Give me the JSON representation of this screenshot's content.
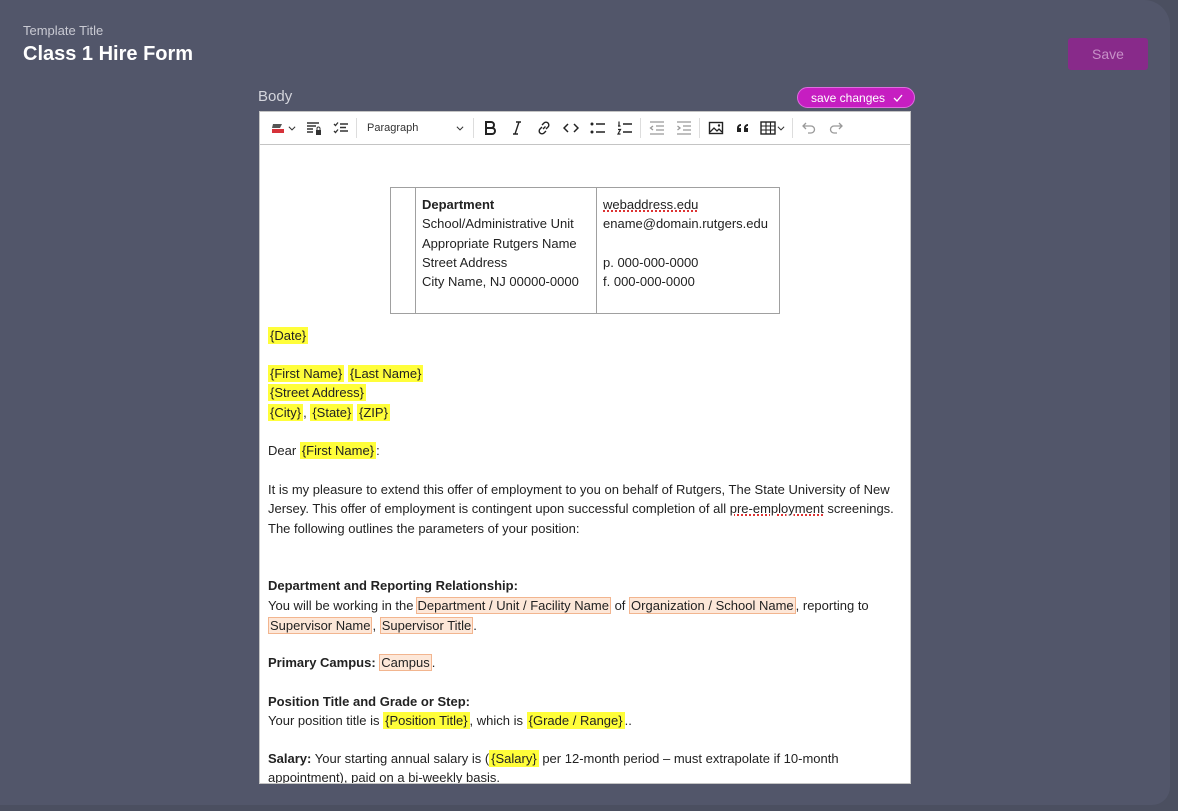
{
  "header": {
    "template_title_label": "Template Title",
    "template_title_value": "Class 1 Hire Form",
    "save_label": "Save"
  },
  "editor": {
    "body_label": "Body",
    "save_changes_label": "save changes",
    "toolbar": {
      "paragraph_select": "Paragraph",
      "icons": [
        "highlight-icon",
        "lock-list-icon",
        "task-list-icon",
        "bold-icon",
        "italic-icon",
        "link-icon",
        "code-icon",
        "bulleted-list-icon",
        "numbered-list-icon",
        "outdent-icon",
        "indent-icon",
        "image-icon",
        "blockquote-icon",
        "table-icon",
        "undo-icon",
        "redo-icon"
      ]
    },
    "letterhead": {
      "left": [
        "Department",
        "School/Administrative Unit",
        "Appropriate Rutgers Name",
        "Street Address",
        "City Name, NJ 00000-0000"
      ],
      "right": [
        "webaddress.edu",
        "ename@domain.rutgers.edu",
        "",
        "p. 000-000-0000",
        "f. 000-000-0000"
      ]
    },
    "doc": {
      "date": "{Date}",
      "first_name": "{First Name}",
      "last_name": "{Last Name}",
      "street_address": "{Street Address}",
      "city": "{City}",
      "comma": ",",
      "state": "{State}",
      "zip": "{ZIP}",
      "dear": "Dear",
      "colon": ":",
      "intro_1": "It is my pleasure to extend this offer of employment to you on behalf of Rutgers, The State University of New Jersey. This offer of employment is contingent upon successful completion of all",
      "intro_spell": "pre-employment",
      "intro_2": "screenings.",
      "outline": "The following outlines the parameters of your position:",
      "dept_heading": "Department and Reporting Relationship:",
      "dept_text_1": "You will be working in the",
      "dept_ph": "Department / Unit / Facility Name",
      "of": "of",
      "org_ph": "Organization / School Name",
      "reporting": ", reporting",
      "to": "to",
      "sup_name_ph": "Supervisor Name",
      "sup_title_ph": "Supervisor Title",
      "period": ".",
      "campus_label": "Primary Campus:",
      "campus_ph": "Campus",
      "pos_heading": "Position Title and Grade or Step:",
      "pos_text": "Your position title is",
      "position_title": "{Position Title}",
      "which_is": ", which is",
      "grade": "{Grade / Range}",
      "double_period": "..",
      "salary_label": "Salary:",
      "salary_text_1": "Your starting annual salary is (",
      "salary_ph": "{Salary}",
      "salary_text_2": "per 12-month period – must extrapolate if 10-month",
      "salary_text_3": "appointment), paid on a bi-weekly basis."
    }
  }
}
